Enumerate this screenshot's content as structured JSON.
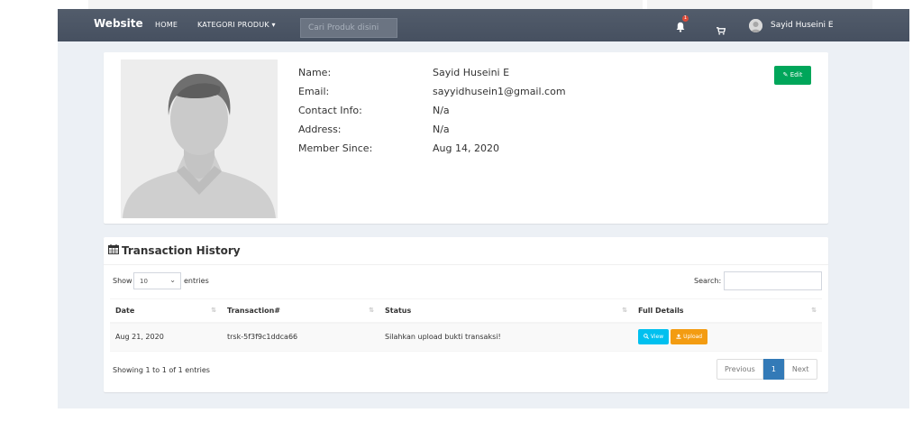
{
  "navbar": {
    "brand": "Website",
    "home": "HOME",
    "kategori": "KATEGORI PRODUK ▾",
    "search_placeholder": "Cari Produk disini",
    "notif_count": "1",
    "username": "Sayid Huseini E"
  },
  "profile": {
    "labels": {
      "name": "Name:",
      "email": "Email:",
      "contact": "Contact Info:",
      "address": "Address:",
      "member_since": "Member Since:"
    },
    "values": {
      "name": "Sayid Huseini E",
      "email": "sayyidhusein1@gmail.com",
      "contact": "N/a",
      "address": "N/a",
      "member_since": "Aug 14, 2020"
    },
    "edit_label": "✎ Edit"
  },
  "transactions": {
    "title": "Transaction History",
    "show": "Show",
    "entries_value": "10",
    "entries": "entries",
    "search_label": "Search:",
    "headers": [
      "Date",
      "Transaction#",
      "Status",
      "Full Details"
    ],
    "rows": [
      {
        "date": "Aug 21, 2020",
        "id": "trsk-5f3f9c1ddca66",
        "status": "Silahkan upload bukti transaksi!",
        "view": "View",
        "upload": "Upload"
      }
    ],
    "showing": "Showing 1 to 1 of 1 entries",
    "pager": {
      "previous": "Previous",
      "current": "1",
      "next": "Next"
    }
  },
  "colors": {
    "navbar": "#4b5563",
    "edit": "#00a65a",
    "view": "#00c0ef",
    "upload": "#f39c12",
    "pager_active": "#337ab7"
  }
}
